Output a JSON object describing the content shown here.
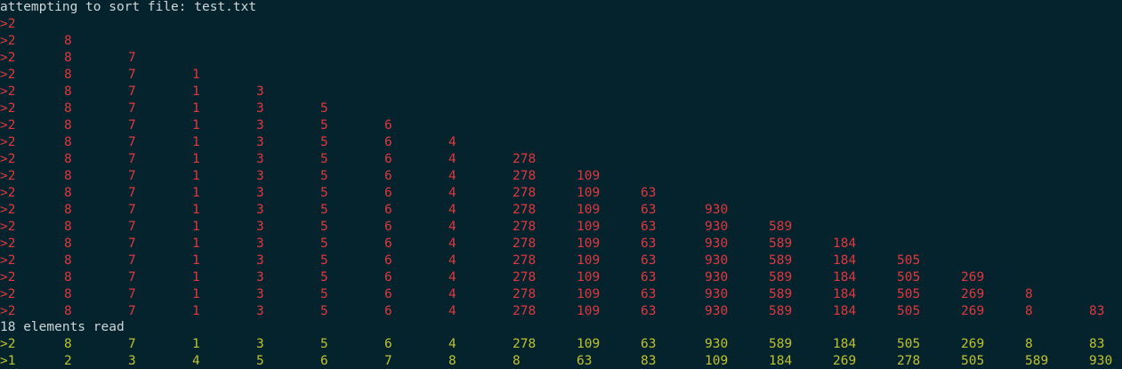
{
  "terminal": {
    "header": "attempting to sort file: test.txt",
    "progress_prefix": ">",
    "progress_rows": [
      [
        "2"
      ],
      [
        "2",
        "8"
      ],
      [
        "2",
        "8",
        "7"
      ],
      [
        "2",
        "8",
        "7",
        "1"
      ],
      [
        "2",
        "8",
        "7",
        "1",
        "3"
      ],
      [
        "2",
        "8",
        "7",
        "1",
        "3",
        "5"
      ],
      [
        "2",
        "8",
        "7",
        "1",
        "3",
        "5",
        "6"
      ],
      [
        "2",
        "8",
        "7",
        "1",
        "3",
        "5",
        "6",
        "4"
      ],
      [
        "2",
        "8",
        "7",
        "1",
        "3",
        "5",
        "6",
        "4",
        "278"
      ],
      [
        "2",
        "8",
        "7",
        "1",
        "3",
        "5",
        "6",
        "4",
        "278",
        "109"
      ],
      [
        "2",
        "8",
        "7",
        "1",
        "3",
        "5",
        "6",
        "4",
        "278",
        "109",
        "63"
      ],
      [
        "2",
        "8",
        "7",
        "1",
        "3",
        "5",
        "6",
        "4",
        "278",
        "109",
        "63",
        "930"
      ],
      [
        "2",
        "8",
        "7",
        "1",
        "3",
        "5",
        "6",
        "4",
        "278",
        "109",
        "63",
        "930",
        "589"
      ],
      [
        "2",
        "8",
        "7",
        "1",
        "3",
        "5",
        "6",
        "4",
        "278",
        "109",
        "63",
        "930",
        "589",
        "184"
      ],
      [
        "2",
        "8",
        "7",
        "1",
        "3",
        "5",
        "6",
        "4",
        "278",
        "109",
        "63",
        "930",
        "589",
        "184",
        "505"
      ],
      [
        "2",
        "8",
        "7",
        "1",
        "3",
        "5",
        "6",
        "4",
        "278",
        "109",
        "63",
        "930",
        "589",
        "184",
        "505",
        "269"
      ],
      [
        "2",
        "8",
        "7",
        "1",
        "3",
        "5",
        "6",
        "4",
        "278",
        "109",
        "63",
        "930",
        "589",
        "184",
        "505",
        "269",
        "8"
      ],
      [
        "2",
        "8",
        "7",
        "1",
        "3",
        "5",
        "6",
        "4",
        "278",
        "109",
        "63",
        "930",
        "589",
        "184",
        "505",
        "269",
        "8",
        "83"
      ]
    ],
    "elements_read": "18 elements read",
    "original_row": [
      "2",
      "8",
      "7",
      "1",
      "3",
      "5",
      "6",
      "4",
      "278",
      "109",
      "63",
      "930",
      "589",
      "184",
      "505",
      "269",
      "8",
      "83"
    ],
    "sorted_row": [
      "1",
      "2",
      "3",
      "4",
      "5",
      "6",
      "7",
      "8",
      "8",
      "63",
      "83",
      "109",
      "184",
      "269",
      "278",
      "505",
      "589",
      "930"
    ]
  },
  "colors": {
    "background": "#04232d",
    "plain_text": "#cfd6d8",
    "progress_text": "#e0383e",
    "result_text": "#c0c22f"
  }
}
